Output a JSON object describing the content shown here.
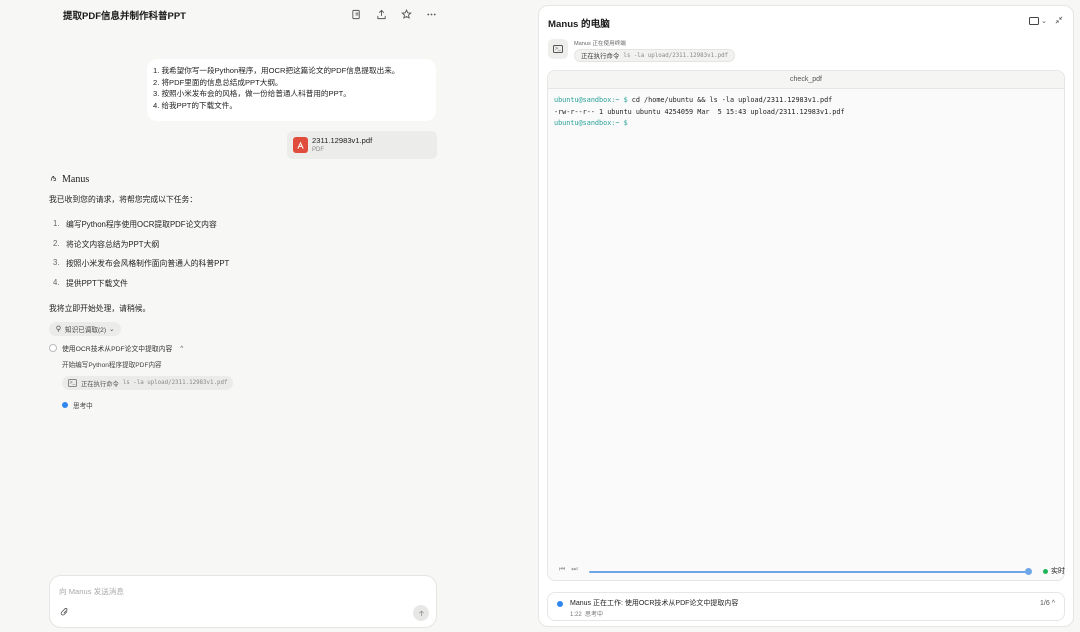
{
  "chat": {
    "title": "提取PDF信息并制作科普PPT",
    "header_icons": [
      "share-doc-icon",
      "upload-icon",
      "star-icon",
      "more-icon"
    ],
    "user_message": {
      "lines": [
        "1. 我希望你写一段Python程序，用OCR把这篇论文的PDF信息提取出来。",
        "2. 将PDF里面的信息总结成PPT大纲。",
        "3. 按照小米发布会的风格，做一份给普通人科普用的PPT。",
        "4. 给我PPT的下载文件。"
      ]
    },
    "attachment": {
      "name": "2311.12983v1.pdf",
      "type": "PDF"
    },
    "assistant_name": "Manus",
    "intro": "我已收到您的请求，将帮您完成以下任务：",
    "tasks": [
      {
        "num": "1.",
        "text": "编写Python程序使用OCR提取PDF论文内容"
      },
      {
        "num": "2.",
        "text": "将论文内容总结为PPT大纲"
      },
      {
        "num": "3.",
        "text": "按照小米发布会风格制作面向普通人的科普PPT"
      },
      {
        "num": "4.",
        "text": "提供PPT下载文件"
      }
    ],
    "closing": "我将立即开始处理，请稍候。",
    "knowledge_pill": "知识已调取(2)",
    "step_title": "使用OCR技术从PDF论文中提取内容",
    "substep": "开始编写Python程序提取PDF内容",
    "cmd_label": "正在执行命令",
    "cmd_text": "ls -la upload/2311.12983v1.pdf",
    "thinking": "思考中",
    "composer_placeholder": "向 Manus 发送消息"
  },
  "computer": {
    "title": "Manus 的电脑",
    "status_label": "Manus 正在使用终端",
    "status_action": "正在执行命令",
    "status_cmd": "ls -la upload/2311.12983v1.pdf",
    "terminal_title": "check_pdf",
    "terminal_lines": [
      {
        "prompt": "ubuntu@sandbox:~ $",
        "text": " cd /home/ubuntu && ls -la upload/2311.12983v1.pdf"
      },
      {
        "prompt": "",
        "text": "-rw-r--r-- 1 ubuntu ubuntu 4254059 Mar  5 15:43 upload/2311.12983v1.pdf"
      },
      {
        "prompt": "ubuntu@sandbox:~ $",
        "text": ""
      }
    ],
    "live_label": "实时",
    "progress": 1.0,
    "footer_title": "Manus 正在工作: 使用OCR技术从PDF论文中提取内容",
    "footer_time": "1:22",
    "footer_status": "思考中",
    "footer_page": "1/6"
  },
  "colors": {
    "accent": "#2f86f0",
    "live": "#22b45b",
    "pdf": "#e04b3c"
  }
}
